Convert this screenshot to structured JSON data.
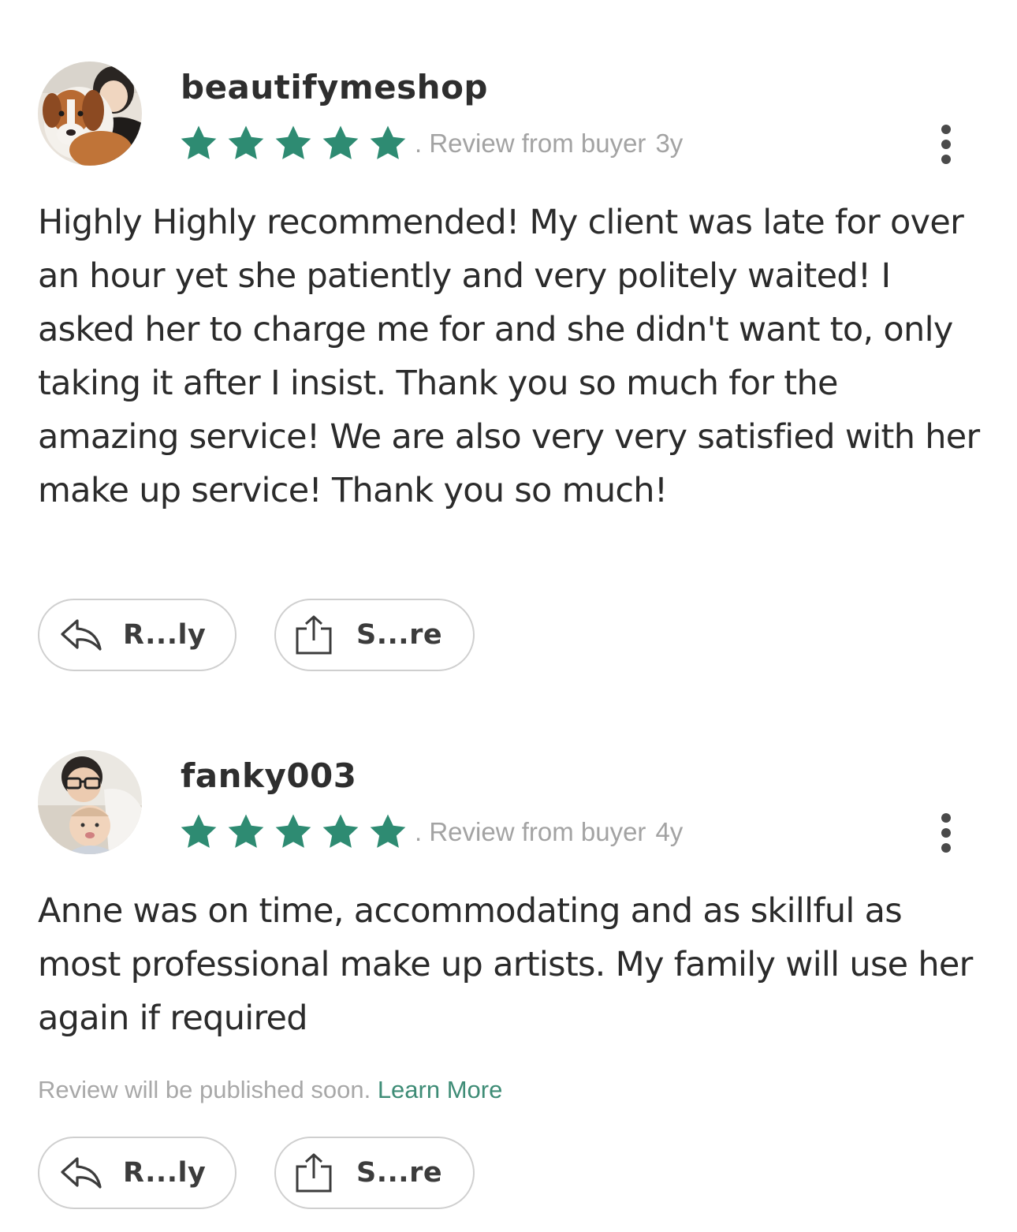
{
  "colors": {
    "star": "#2e8b72",
    "link": "#3e8c76",
    "muted": "#a3a3a3",
    "text": "#2b2b2b"
  },
  "reviews": [
    {
      "username": "beautifymeshop",
      "rating": 5,
      "meta": ". Review from buyer",
      "age": "3y",
      "text": "Highly Highly recommended! My client was late for over an hour yet she patiently and very politely waited! I asked her to charge me for and she didn't want to, only taking it after I insist. Thank you so much for the amazing service! We are also very very satisfied with her make up service! Thank you so much!",
      "reply_label": "R...ly",
      "share_label": "S...re",
      "avatar_icon": "user-avatar-with-dog"
    },
    {
      "username": "fanky003",
      "rating": 5,
      "meta": ". Review from buyer",
      "age": "4y",
      "text": "Anne was on time, accommodating and as skillful as most professional make up artists. My family will use her again if required",
      "notice": "Review will be published soon.",
      "learn_more": "Learn More",
      "reply_label": "R...ly",
      "share_label": "S...re",
      "avatar_icon": "user-avatar-with-baby"
    }
  ]
}
